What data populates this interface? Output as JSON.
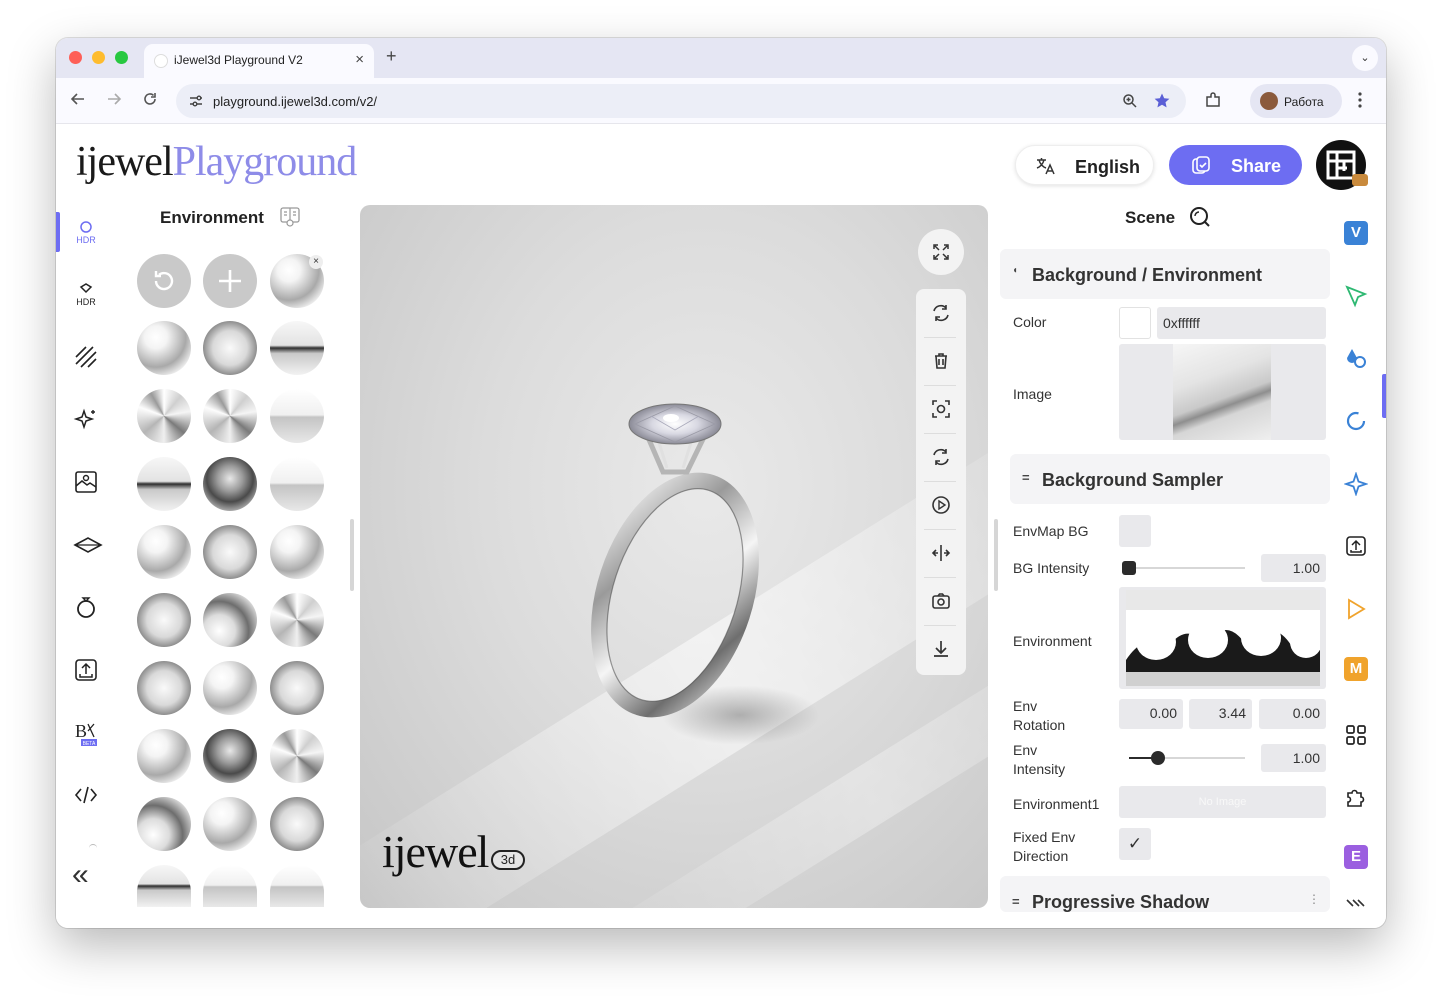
{
  "browser": {
    "tab_title": "iJewel3d Playground V2",
    "url": "playground.ijewel3d.com/v2/",
    "profile_name": "Работа",
    "new_tab_label": "+",
    "tab_close_label": "×",
    "tab_menu_label": "⌄"
  },
  "app": {
    "logo_part1": "ijewel",
    "logo_part2": "Playground",
    "language_label": "English",
    "share_label": "Share"
  },
  "left_rail": {
    "items": [
      {
        "icon": "hdr-icon",
        "label": "HDR"
      },
      {
        "icon": "hdr-diamond-icon",
        "label": "HDR"
      },
      {
        "icon": "stripes-icon",
        "label": ""
      },
      {
        "icon": "sparkles-icon",
        "label": ""
      },
      {
        "icon": "gallery-icon",
        "label": ""
      },
      {
        "icon": "plane-icon",
        "label": ""
      },
      {
        "icon": "ring-icon",
        "label": ""
      },
      {
        "icon": "upload-icon",
        "label": ""
      },
      {
        "icon": "bk-beta-icon",
        "label": "BETA"
      },
      {
        "icon": "code-icon",
        "label": ""
      }
    ],
    "collapse_label": "«"
  },
  "environment_panel": {
    "title": "Environment",
    "close_label": "×"
  },
  "scene_panel": {
    "title": "Scene",
    "sections": {
      "background": "Background / Environment",
      "sampler": "Background Sampler",
      "shadow": "Progressive Shadow"
    },
    "props": {
      "color_label": "Color",
      "color_value": "0xffffff",
      "image_label": "Image",
      "envmap_bg_label": "EnvMap BG",
      "bg_intensity_label": "BG Intensity",
      "bg_intensity_value": "1.00",
      "bg_intensity_level": 0.0,
      "environment_label": "Environment",
      "env_rotation_label": "Env Rotation",
      "env_rotation_x": "0.00",
      "env_rotation_y": "3.44",
      "env_rotation_z": "0.00",
      "env_intensity_label": "Env Intensity",
      "env_intensity_value": "1.00",
      "env_intensity_level": 0.25,
      "environment1_label": "Environment1",
      "environment1_placeholder": "No Image",
      "fixed_env_label": "Fixed Env Direction",
      "fixed_env_checked": "✓"
    }
  },
  "viewport": {
    "logo_text": "ijewel",
    "logo_badge": "3d",
    "tools": [
      "fullscreen-icon",
      "rotate-icon",
      "trash-icon",
      "focus-icon",
      "autorotate-icon",
      "play-icon",
      "compare-icon",
      "camera-icon",
      "download-icon"
    ]
  },
  "right_rail": {
    "badges": [
      {
        "letter": "V",
        "color": "#3a82d6"
      },
      {
        "letter": "M",
        "color": "#f0a32c"
      },
      {
        "letter": "E",
        "color": "#9b5fe0"
      }
    ],
    "icons": [
      "cursor-icon",
      "material-icon",
      "rotation-icon",
      "star-icon",
      "import-icon",
      "play-icon",
      "grid-icon",
      "puzzle-icon",
      "expand-icon"
    ]
  },
  "colors": {
    "accent": "#6d6df2",
    "logo_purple": "#8e8ce8"
  }
}
